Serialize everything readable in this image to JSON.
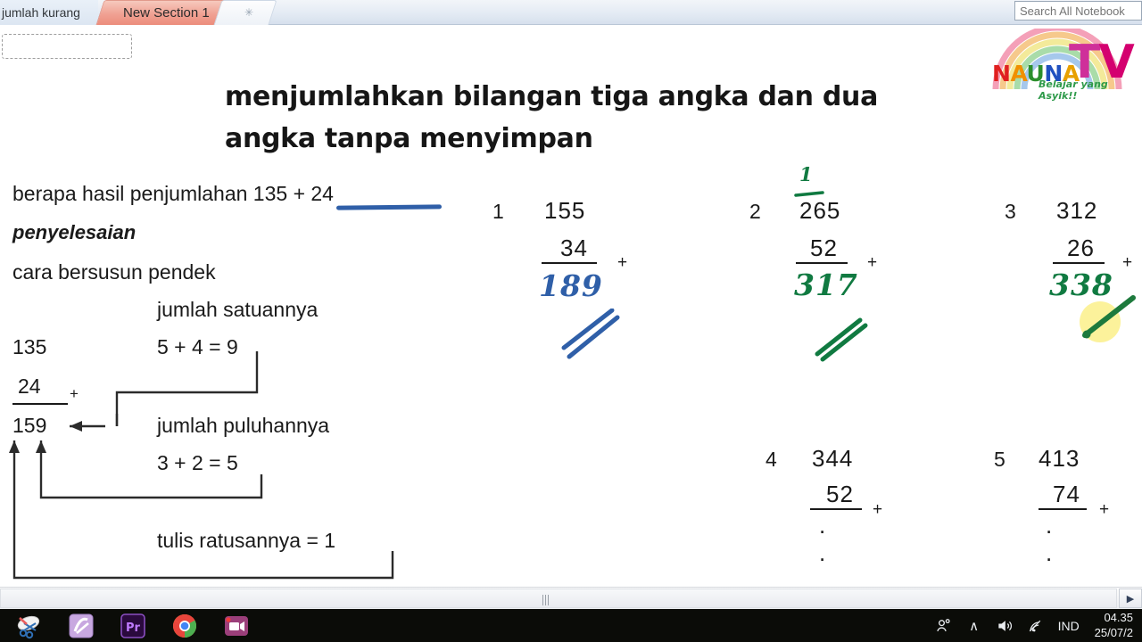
{
  "window": {
    "tabs": [
      {
        "label": "jumlah kurang",
        "state": "inactive"
      },
      {
        "label": "New Section 1",
        "state": "active"
      },
      {
        "label": "✳",
        "state": "new-tab"
      }
    ],
    "search": {
      "value": "",
      "placeholder": "Search All Notebook"
    },
    "page_title": {
      "value": "",
      "placeholder": ""
    }
  },
  "logo": {
    "word1": [
      "N",
      "A",
      "U",
      "N",
      "A"
    ],
    "word2": [
      "T",
      "V"
    ],
    "tagline": "Belajar yang Asyik!!"
  },
  "lesson": {
    "title": "menjumlahkan bilangan tiga angka dan dua angka tanpa menyimpan",
    "question": "berapa hasil penjumlahan 135 + 24",
    "solution_label": "penyelesaian",
    "method": "cara bersusun pendek",
    "worked_example": {
      "addend_top": "135",
      "addend_bottom": "24",
      "operator": "+",
      "sum": "159"
    },
    "annotations": {
      "ones_label": "jumlah satuannya",
      "ones_calc": "5 + 4 = 9",
      "tens_label": "jumlah puluhannya",
      "tens_calc": "3 + 2 = 5",
      "hundreds_label": "tulis ratusannya = 1"
    }
  },
  "exercises": [
    {
      "number": "1",
      "top": "155",
      "bottom": "34",
      "operator": "+",
      "answer": "189",
      "answer_color": "#2f5fa8",
      "carry": "",
      "placeholder": ""
    },
    {
      "number": "2",
      "top": "265",
      "bottom": "52",
      "operator": "+",
      "answer": "317",
      "answer_color": "#107a41",
      "carry": "1",
      "placeholder": ""
    },
    {
      "number": "3",
      "top": "312",
      "bottom": "26",
      "operator": "+",
      "answer": "338",
      "answer_color": "#107a41",
      "carry": "",
      "placeholder": ""
    },
    {
      "number": "4",
      "top": "344",
      "bottom": "52",
      "operator": "+",
      "answer": "",
      "answer_color": "",
      "carry": "",
      "placeholder": ". . ."
    },
    {
      "number": "5",
      "top": "413",
      "bottom": "74",
      "operator": "+",
      "answer": "",
      "answer_color": "",
      "carry": "",
      "placeholder": ". . ."
    }
  ],
  "scrollbar": {
    "right_arrow": "▶"
  },
  "taskbar": {
    "apps": [
      "snipping-tool",
      "onenote",
      "premiere-pro",
      "chrome",
      "screen-recorder"
    ],
    "tray": {
      "people": "people-icon",
      "overflow": "∧",
      "volume": "volume-icon",
      "network": "wifi-icon",
      "language": "IND"
    },
    "clock": {
      "time": "04.35",
      "date": "25/07/2"
    }
  },
  "colors": {
    "pen_blue": "#2f5fa8",
    "pen_green": "#107a41",
    "tab_active": "#ec8d7c",
    "highlight": "#fbf08a"
  }
}
